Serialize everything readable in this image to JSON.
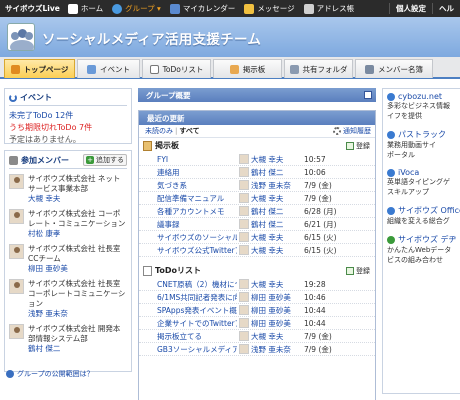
{
  "topbar": {
    "brand": "サイボウズLive",
    "items": [
      {
        "label": "ホーム",
        "icon": "home-icon",
        "color": "#ffffff"
      },
      {
        "label": "グループ ▾",
        "icon": "group-icon",
        "color": "#4a9ae0",
        "active": true
      },
      {
        "label": "マイカレンダー",
        "icon": "calendar-icon",
        "color": "#5a8ad0"
      },
      {
        "label": "メッセージ",
        "icon": "message-icon",
        "color": "#f0c040"
      },
      {
        "label": "アドレス帳",
        "icon": "address-book-icon",
        "color": "#d0d0d0"
      }
    ],
    "right": [
      "個人設定",
      "ヘル"
    ]
  },
  "header": {
    "title": "ソーシャルメディア活用支援チーム"
  },
  "tabs": [
    {
      "label": "トップページ",
      "icon": "home-icon",
      "active": true
    },
    {
      "label": "イベント",
      "icon": "event-icon"
    },
    {
      "label": "ToDoリスト",
      "icon": "todo-icon"
    },
    {
      "label": "掲示板",
      "icon": "board-icon"
    },
    {
      "label": "共有フォルダ",
      "icon": "folder-icon"
    },
    {
      "label": "メンバー名簿",
      "icon": "members-icon"
    }
  ],
  "events": {
    "title": "イベント",
    "line1": "未完了ToDo 12件",
    "line2": "うち期限切れToDo 7件",
    "line3": "予定はありません。"
  },
  "members": {
    "title": "参加メンバー",
    "add_label": "追加する",
    "list": [
      {
        "org": "サイボウズ株式会社 ネットサービス事業本部",
        "name": "大槻 幸夫"
      },
      {
        "org": "サイボウズ株式会社 コーポレート・コミュニケーション",
        "name": "村松 康孝"
      },
      {
        "org": "サイボウズ株式会社 社長室 CCチーム",
        "name": "柳田 亜砂美"
      },
      {
        "org": "サイボウズ株式会社 社長室 コーポレートコミュニケーション",
        "name": "浅野 亜未奈"
      },
      {
        "org": "サイボウズ株式会社 開発本部情報システム部",
        "name": "鶴村 傑二"
      }
    ],
    "public_link": "グループの公開範囲は？"
  },
  "group_overview": {
    "title": "グループ概要"
  },
  "recent": {
    "title": "最近の更新",
    "filter_unread": "未読のみ",
    "filter_sep": "|",
    "filter_all": "すべて",
    "settings": "通知履歴",
    "board": {
      "title": "掲示板",
      "register": "登録",
      "rows": [
        {
          "title": "FYI",
          "author": "大槻 幸夫",
          "date": "10:57"
        },
        {
          "title": "連絡用",
          "author": "鶴村 傑二",
          "date": "10:06"
        },
        {
          "title": "気づき系",
          "author": "浅野 亜未奈",
          "date": "7/9 (金)"
        },
        {
          "title": "配信準備マニュアル",
          "author": "大槻 幸夫",
          "date": "7/9 (金)"
        },
        {
          "title": "各種アカウントメモ",
          "author": "鶴村 傑二",
          "date": "6/28 (月)"
        },
        {
          "title": "議事録",
          "author": "鶴村 傑二",
          "date": "6/21 (月)"
        },
        {
          "title": "サイボウズのソーシャルメディ",
          "author": "大槻 幸夫",
          "date": "6/15 (火)"
        },
        {
          "title": "サイボウズ公式Twitterアカウ",
          "author": "大槻 幸夫",
          "date": "6/15 (火)"
        }
      ]
    },
    "todo": {
      "title": "ToDoリスト",
      "register": "登録",
      "rows": [
        {
          "title": "CNET原稿（2）機材について",
          "author": "大槻 幸夫",
          "date": "19:28"
        },
        {
          "title": "6/1MS共同記者発表に向けて",
          "author": "柳田 亜砂美",
          "date": "10:46"
        },
        {
          "title": "SPApps発表イベント概要・ス",
          "author": "柳田 亜砂美",
          "date": "10:44"
        },
        {
          "title": "企業サイトでのTwitterアカウ",
          "author": "柳田 亜砂美",
          "date": "10:44"
        },
        {
          "title": "掲示板立てる",
          "author": "大槻 幸夫",
          "date": "7/9 (金)"
        },
        {
          "title": "GB3ソーシャルメディアマーケ",
          "author": "浅野 亜未奈",
          "date": "7/9 (金)"
        }
      ]
    }
  },
  "links": [
    {
      "head": "cybozu.net",
      "color": "#3a7ad0",
      "lines": [
        "多彩なビジネス情報",
        "イフを提供"
      ]
    },
    {
      "head": "パストラック",
      "color": "#3a7ad0",
      "lines": [
        "業務用動画サイ",
        "ポータル"
      ]
    },
    {
      "head": "iVoca",
      "color": "#3a7ad0",
      "lines": [
        "英単語タイピングゲ",
        "スキルアップ"
      ]
    },
    {
      "head": "サイボウズ Office",
      "color": "#3a7ad0",
      "lines": [
        "組織を変える総合グ"
      ]
    },
    {
      "head": "サイボウズ デヂ",
      "color": "#3a9a3a",
      "lines": [
        "かんたんWebデータ",
        "ビスの組み合わせ"
      ]
    }
  ]
}
